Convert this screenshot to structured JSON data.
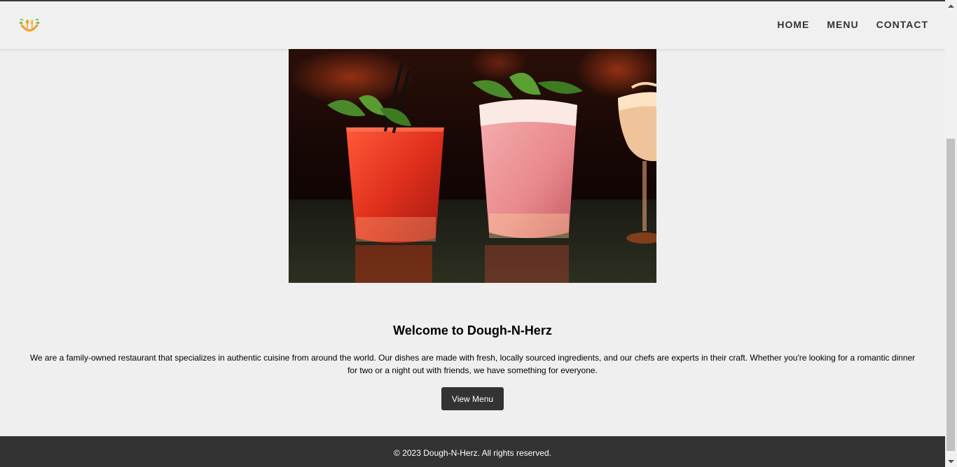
{
  "header": {
    "logo_icon": "fork-spoon-leaf-logo",
    "nav": [
      {
        "label": "HOME"
      },
      {
        "label": "MENU"
      },
      {
        "label": "CONTACT"
      }
    ]
  },
  "hero": {
    "image_subject": "three cocktails on a bar counter"
  },
  "main": {
    "title": "Welcome to Dough-N-Herz",
    "description": "We are a family-owned restaurant that specializes in authentic cuisine from around the world. Our dishes are made with fresh, locally sourced ingredients, and our chefs are experts in their craft. Whether you're looking for a romantic dinner for two or a night out with friends, we have something for everyone.",
    "button_label": "View Menu"
  },
  "footer": {
    "copyright": "© 2023 Dough-N-Herz. All rights reserved."
  },
  "colors": {
    "background": "#efefef",
    "dark": "#333333",
    "logo_orange": "#f0a020",
    "logo_green": "#6cbf3a"
  }
}
